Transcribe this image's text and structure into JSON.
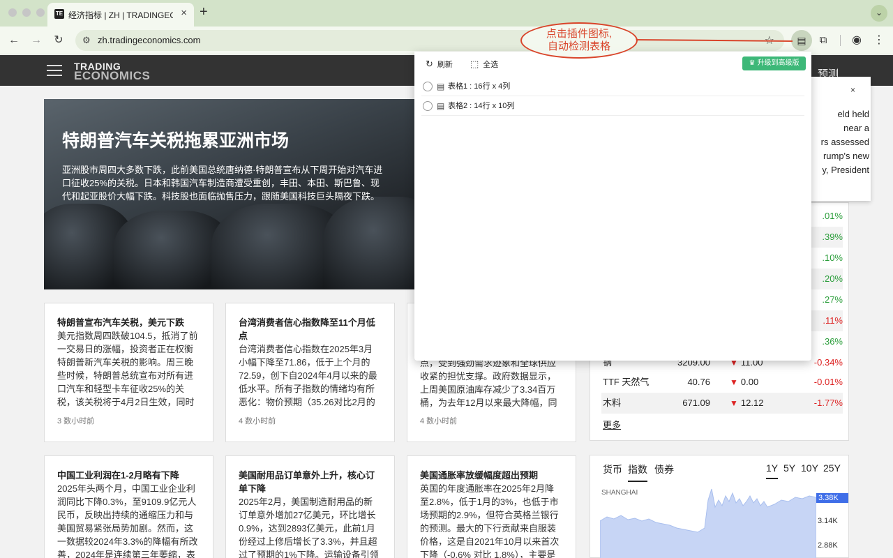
{
  "browser": {
    "tab_title": "经济指标 | ZH | TRADINGECONOMICS",
    "favicon_text": "TE",
    "url": "zh.tradingeconomics.com"
  },
  "callout": {
    "line1": "点击插件图标,",
    "line2": "自动检测表格"
  },
  "site": {
    "logo_line1": "TRADING",
    "logo_line2": "ECONOMICS",
    "header_forecast": "预测"
  },
  "hero": {
    "title": "特朗普汽车关税拖累亚洲市场",
    "text": "亚洲股市周四大多数下跌，此前美国总统唐纳德·特朗普宣布从下周开始对汽车进口征收25%的关税。日本和韩国汽车制造商遭受重创，丰田、本田、斯巴鲁、现代和起亚股价大幅下跌。科技股也面临抛售压力，跟随美国科技巨头隔夜下跌。"
  },
  "cards": [
    {
      "title": "特朗普宣布汽车关税，美元下跌",
      "body": "美元指数周四跌破104.5，抵消了前一交易日的涨幅，投资者正在权衡特朗普新汽车关税的影响。周三晚些时候，特朗普总统宣布对所有进口汽车和轻型卡车征收25%的关税，该关税将于4月2日生效，同时",
      "time": "3 数小时前"
    },
    {
      "title": "台湾消费者信心指数降至11个月低点",
      "body": "台湾消费者信心指数在2025年3月小幅下降至71.86，低于上个月的72.59，创下自2024年4月以来的最低水平。所有子指数的情绪均有所恶化：物价预期（35.26对比2月的",
      "time": "4 数小时前"
    },
    {
      "title": "",
      "body": "点，受到强劲需求迹象和全球供应收紧的担忧支撑。政府数据显示，上周美国原油库存减少了3.34百万桶，为去年12月以来最大降幅，同",
      "time": "4 数小时前"
    },
    {
      "title": "中国工业利润在1-2月略有下降",
      "body": "2025年头两个月，中国工业企业利润同比下降0.3%，至9109.9亿元人民币，反映出持续的通缩压力和与美国贸易紧张局势加剧。然而，这一数据较2024年3.3%的降幅有所改善，2024年是连续第三年萎缩，表",
      "time": ""
    },
    {
      "title": "美国耐用品订单意外上升，核心订单下降",
      "body": "2025年2月，美国制造耐用品的新订单意外增加27亿美元，环比增长0.9%，达到2893亿美元，此前1月份经过上修后增长了3.3%，并且超过了预期的1%下降。运输设备引领",
      "time": ""
    },
    {
      "title": "美国通胀率放缓幅度超出预期",
      "body": "英国的年度通胀率在2025年2月降至2.8%，低于1月的3%，也低于市场预期的2.9%，但符合英格兰银行的预测。最大的下行贡献来自服装价格，这是自2021年10月以来首次下降（-0.6% 对比 1.8%），主要是",
      "time": ""
    }
  ],
  "commodities": {
    "partial_pcts": [
      ".01%",
      ".39%",
      ".10%",
      ".20%",
      ".27%",
      ".11%",
      ".36%"
    ],
    "partial_up": [
      true,
      true,
      true,
      true,
      true,
      false,
      true
    ],
    "rows": [
      {
        "name": "钢",
        "price": "3209.00",
        "change": "11.00",
        "pct": "-0.34%"
      },
      {
        "name": "TTF 天然气",
        "price": "40.76",
        "change": "0.00",
        "pct": "-0.01%"
      },
      {
        "name": "木料",
        "price": "671.09",
        "change": "12.12",
        "pct": "-1.77%"
      }
    ],
    "more": "更多"
  },
  "tooltip": {
    "close": "×",
    "lines": [
      "eld held",
      "near a",
      "rs assessed",
      "rump's new",
      "y, President"
    ]
  },
  "index_panel": {
    "tabs": [
      "货币",
      "指数",
      "债券"
    ],
    "active_tab": "指数",
    "ranges": [
      "1Y",
      "5Y",
      "10Y",
      "25Y"
    ],
    "active_range": "1Y",
    "label": "SHANGHAI",
    "y_ticks": [
      "3.38K",
      "3.14K",
      "2.88K"
    ],
    "highlight_color": "#3f6ee8",
    "area_color": "#c7d5f5"
  },
  "popup": {
    "refresh_label": "刷新",
    "select_all_label": "全选",
    "upgrade_label": "升级到高级版",
    "tables": [
      {
        "label": "表格1 : 16行 x 4列"
      },
      {
        "label": "表格2 : 14行 x 10列"
      }
    ]
  }
}
